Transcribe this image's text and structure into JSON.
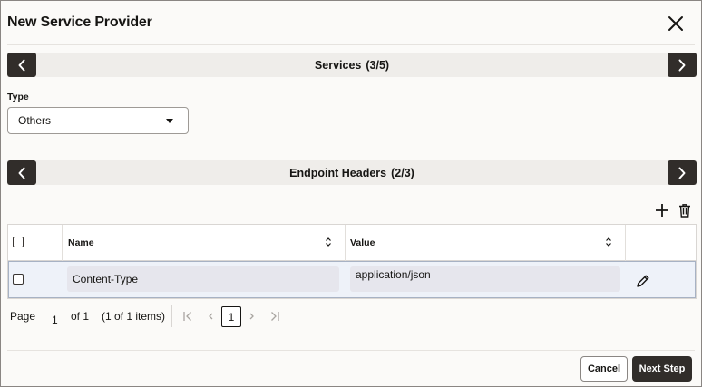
{
  "dialog": {
    "title": "New Service Provider"
  },
  "services_section": {
    "title": "Services",
    "count": "(3/5)"
  },
  "type_field": {
    "label": "Type",
    "value": "Others"
  },
  "endpoint_section": {
    "title": "Endpoint Headers",
    "count": "(2/3)"
  },
  "grid": {
    "columns": [
      "Name",
      "Value"
    ],
    "rows": [
      {
        "name": "Content-Type",
        "value": "application/json"
      }
    ]
  },
  "pagination": {
    "page_label": "Page",
    "current_page": "1",
    "of_label": "of 1",
    "items_label": "(1 of 1 items)",
    "page_number": "1"
  },
  "footer": {
    "cancel_label": "Cancel",
    "next_label": "Next Step"
  },
  "icons": {
    "close": "close-icon",
    "prev": "chevron-left-icon",
    "next": "chevron-right-icon",
    "add": "plus-icon",
    "delete": "trash-icon",
    "sort": "sort-icon",
    "edit": "pencil-icon",
    "first_page": "first-page-icon",
    "prev_page": "prev-page-icon",
    "next_page": "next-page-icon",
    "last_page": "last-page-icon"
  },
  "colors": {
    "dark_button": "#312d2a",
    "section_bar": "#efedea",
    "row_highlight": "#eef2f9"
  }
}
